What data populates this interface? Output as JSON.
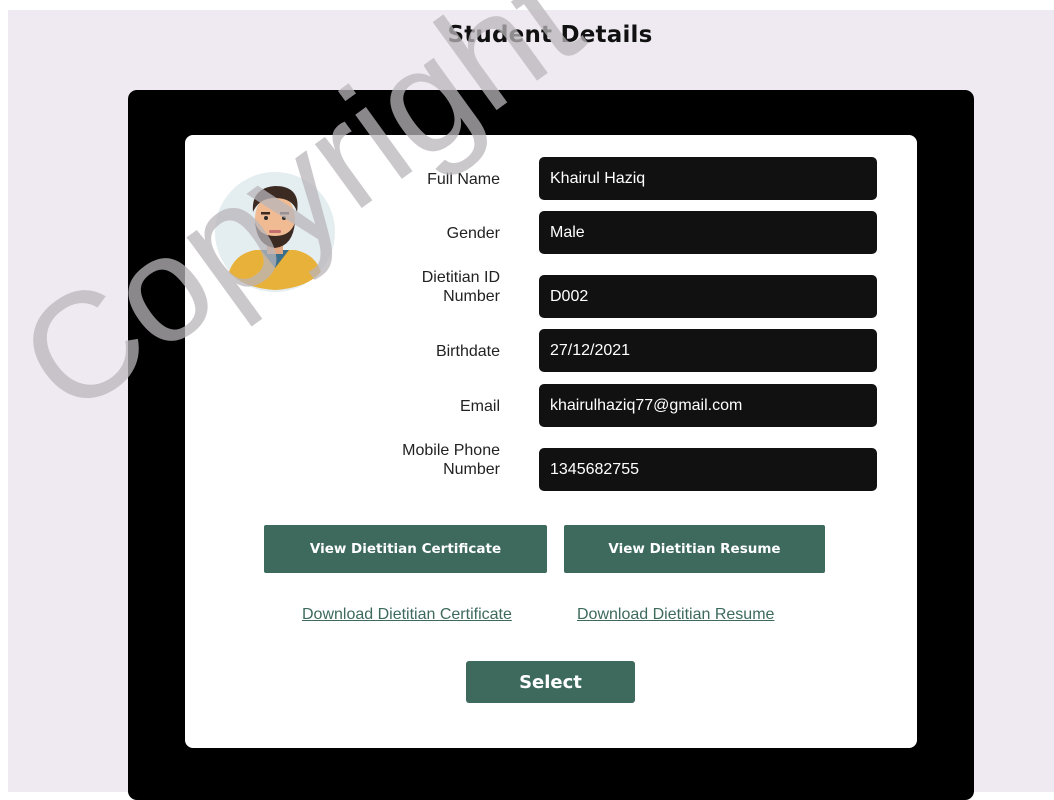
{
  "page": {
    "title": "Student Details"
  },
  "profile": {
    "fields": [
      {
        "label": "Full Name",
        "value": "Khairul Haziq"
      },
      {
        "label": "Gender",
        "value": "Male"
      },
      {
        "label": "Dietitian ID Number",
        "value": "D002"
      },
      {
        "label": "Birthdate",
        "value": "27/12/2021"
      },
      {
        "label": "Email",
        "value": "khairulhaziq77@gmail.com"
      },
      {
        "label": "Mobile Phone Number",
        "value": "1345682755"
      }
    ]
  },
  "actions": {
    "view_certificate": "View Dietitian Certificate",
    "view_resume": "View Dietitian Resume",
    "download_certificate": "Download Dietitian Certificate",
    "download_resume": "Download Dietitian Resume",
    "select": "Select"
  },
  "watermark": {
    "text": "Copyright UKM"
  },
  "colors": {
    "page_bg": "#efeaf1",
    "frame": "#000000",
    "card": "#ffffff",
    "field_bg": "#111111",
    "accent": "#3d6a5d"
  },
  "icons": {
    "avatar": "male-avatar-icon"
  }
}
